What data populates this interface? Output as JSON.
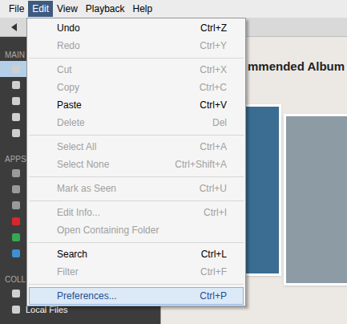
{
  "menubar": [
    {
      "label": "File",
      "selected": false
    },
    {
      "label": "Edit",
      "selected": true
    },
    {
      "label": "View",
      "selected": false
    },
    {
      "label": "Playback",
      "selected": false
    },
    {
      "label": "Help",
      "selected": false
    }
  ],
  "sidebar": {
    "sections": [
      {
        "label": "MAIN",
        "items": [
          {
            "selected": true
          },
          {
            "selected": false
          },
          {
            "selected": false
          },
          {
            "selected": false
          },
          {
            "selected": false
          }
        ]
      },
      {
        "label": "APPS",
        "items": [
          {
            "selected": false,
            "color": "#9a9a9a"
          },
          {
            "selected": false,
            "color": "#9a9a9a"
          },
          {
            "selected": false,
            "color": "#9a9a9a"
          },
          {
            "selected": false,
            "color": "#d9262c"
          },
          {
            "selected": false,
            "color": "#35a853"
          },
          {
            "selected": false,
            "color": "#3d8fd6"
          }
        ]
      },
      {
        "label": "COLL",
        "items": [
          {
            "selected": false,
            "label": ""
          },
          {
            "selected": false,
            "label": "Local Files"
          }
        ]
      }
    ]
  },
  "content": {
    "title": "mmended Album"
  },
  "menu": {
    "items": [
      {
        "kind": "item",
        "label": "Undo",
        "shortcut": "Ctrl+Z",
        "disabled": false,
        "selected": false
      },
      {
        "kind": "item",
        "label": "Redo",
        "shortcut": "Ctrl+Y",
        "disabled": true,
        "selected": false
      },
      {
        "kind": "separator"
      },
      {
        "kind": "item",
        "label": "Cut",
        "shortcut": "Ctrl+X",
        "disabled": true,
        "selected": false
      },
      {
        "kind": "item",
        "label": "Copy",
        "shortcut": "Ctrl+C",
        "disabled": true,
        "selected": false
      },
      {
        "kind": "item",
        "label": "Paste",
        "shortcut": "Ctrl+V",
        "disabled": false,
        "selected": false
      },
      {
        "kind": "item",
        "label": "Delete",
        "shortcut": "Del",
        "disabled": true,
        "selected": false
      },
      {
        "kind": "separator"
      },
      {
        "kind": "item",
        "label": "Select All",
        "shortcut": "Ctrl+A",
        "disabled": true,
        "selected": false
      },
      {
        "kind": "item",
        "label": "Select None",
        "shortcut": "Ctrl+Shift+A",
        "disabled": true,
        "selected": false
      },
      {
        "kind": "separator"
      },
      {
        "kind": "item",
        "label": "Mark as Seen",
        "shortcut": "Ctrl+U",
        "disabled": true,
        "selected": false
      },
      {
        "kind": "separator"
      },
      {
        "kind": "item",
        "label": "Edit Info...",
        "shortcut": "Ctrl+I",
        "disabled": true,
        "selected": false
      },
      {
        "kind": "item",
        "label": "Open Containing Folder",
        "shortcut": "",
        "disabled": true,
        "selected": false
      },
      {
        "kind": "separator"
      },
      {
        "kind": "item",
        "label": "Search",
        "shortcut": "Ctrl+L",
        "disabled": false,
        "selected": false
      },
      {
        "kind": "item",
        "label": "Filter",
        "shortcut": "Ctrl+F",
        "disabled": true,
        "selected": false
      },
      {
        "kind": "separator"
      },
      {
        "kind": "item",
        "label": "Preferences...",
        "shortcut": "Ctrl+P",
        "disabled": false,
        "selected": true
      }
    ]
  }
}
